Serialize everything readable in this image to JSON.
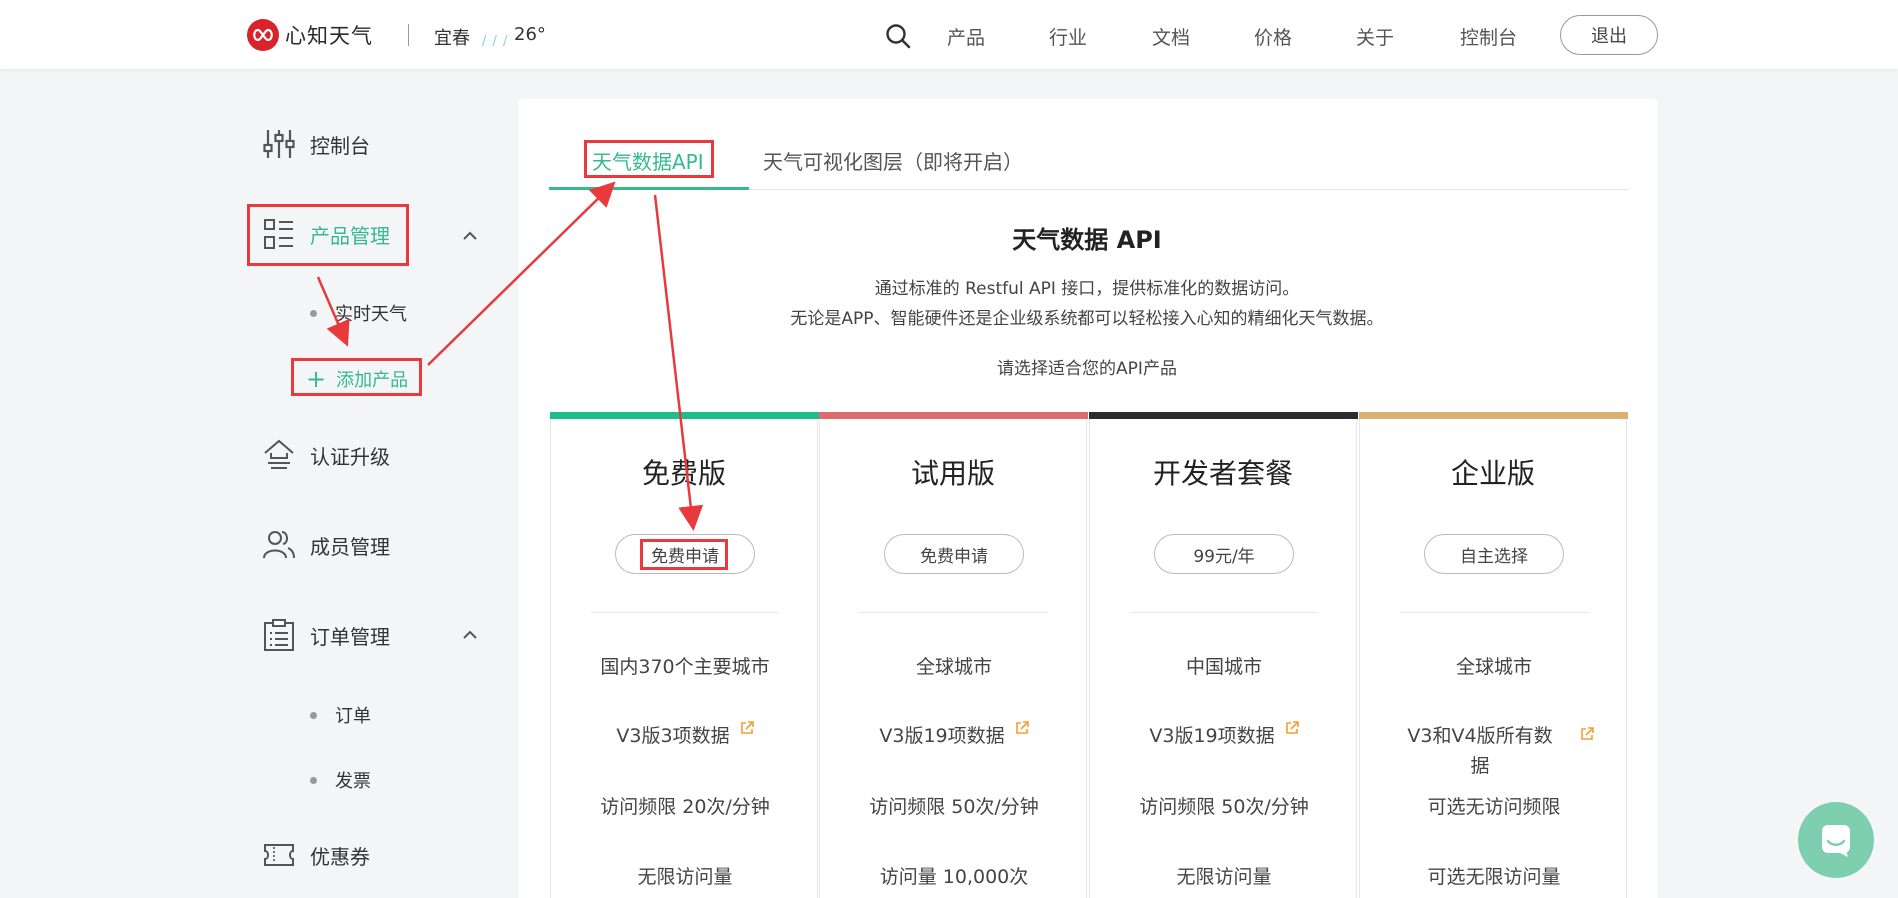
{
  "header": {
    "logo_text": "心知天气",
    "city": "宜春",
    "weather_icon": "rain-icon",
    "temperature": "26°",
    "nav": [
      "产品",
      "行业",
      "文档",
      "价格",
      "关于",
      "控制台"
    ],
    "logout_label": "退出"
  },
  "sidebar": {
    "console": "控制台",
    "product_mgmt": "产品管理",
    "product_sub": [
      "实时天气",
      "添加产品"
    ],
    "cert_upgrade": "认证升级",
    "member_mgmt": "成员管理",
    "order_mgmt": "订单管理",
    "order_sub": [
      "订单",
      "发票"
    ],
    "coupon": "优惠券"
  },
  "tabs": [
    "天气数据API",
    "天气可视化图层（即将开启）"
  ],
  "api": {
    "title": "天气数据 API",
    "desc1": "通过标准的 Restful API 接口，提供标准化的数据访问。",
    "desc2": "无论是APP、智能硬件还是企业级系统都可以轻松接入心知的精细化天气数据。",
    "prompt": "请选择适合您的API产品"
  },
  "plans": [
    {
      "name": "免费版",
      "button": "免费申请",
      "color": "#1ebd8e",
      "features": [
        "国内370个主要城市",
        "V3版3项数据",
        "访问频限 20次/分钟",
        "无限访问量"
      ]
    },
    {
      "name": "试用版",
      "button": "免费申请",
      "color": "#e06b6e",
      "features": [
        "全球城市",
        "V3版19项数据",
        "访问频限 50次/分钟",
        "访问量 10,000次"
      ]
    },
    {
      "name": "开发者套餐",
      "button": "99元/年",
      "color": "#2c2c2c",
      "features": [
        "中国城市",
        "V3版19项数据",
        "访问频限 50次/分钟",
        "无限访问量"
      ]
    },
    {
      "name": "企业版",
      "button": "自主选择",
      "color": "#dcb273",
      "features": [
        "全球城市",
        "V3和V4版所有数据",
        "可选无访问频限",
        "可选无限访问量"
      ]
    }
  ],
  "colors": {
    "accent": "#35b98d",
    "annotation": "#e8393d"
  }
}
